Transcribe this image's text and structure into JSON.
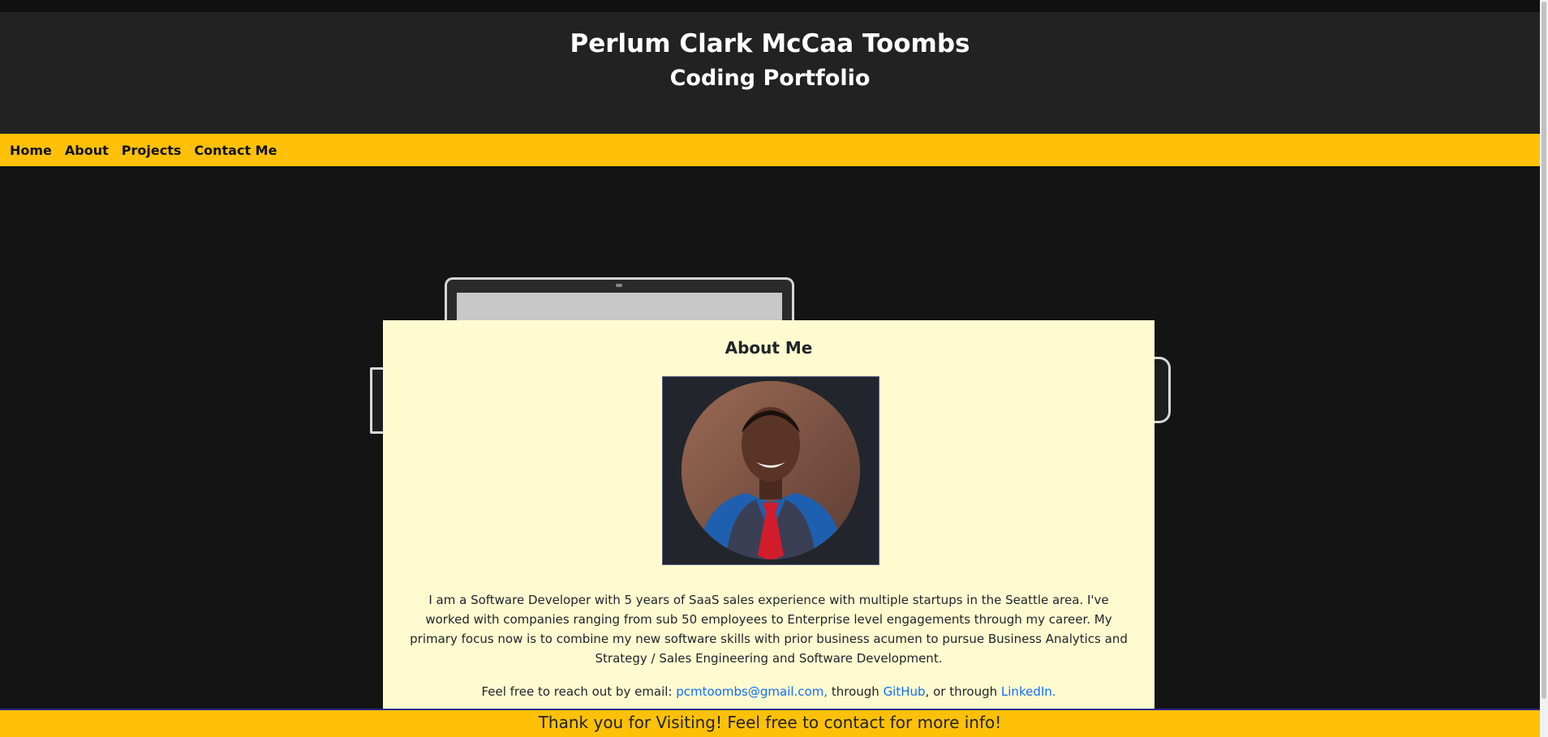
{
  "header": {
    "name": "Perlum Clark McCaa Toombs",
    "subtitle": "Coding Portfolio"
  },
  "nav": {
    "items": [
      {
        "label": "Home"
      },
      {
        "label": "About"
      },
      {
        "label": "Projects"
      },
      {
        "label": "Contact Me"
      }
    ]
  },
  "about": {
    "title": "About Me",
    "bio": "I am a Software Developer with 5 years of SaaS sales experience with multiple startups in the Seattle area. I've worked with companies ranging from sub 50 employees to Enterprise level engagements through my career. My primary focus now is to combine my new software skills with prior business acumen to pursue Business Analytics and Strategy / Sales Engineering and Software Development.",
    "contact_prefix": "Feel free to reach out by email: ",
    "email": "pcmtoombs@gmail.com,",
    "through1": " through ",
    "github": "GitHub",
    "through2": ", or through ",
    "linkedin": "LinkedIn."
  },
  "footer": {
    "text": "Thank you for Visiting! Feel free to contact for more info!"
  },
  "colors": {
    "accent": "#ffc107",
    "header_bg": "#222222",
    "page_bg": "#141414",
    "card_bg": "#fffbd1",
    "link": "#0d6efd"
  }
}
